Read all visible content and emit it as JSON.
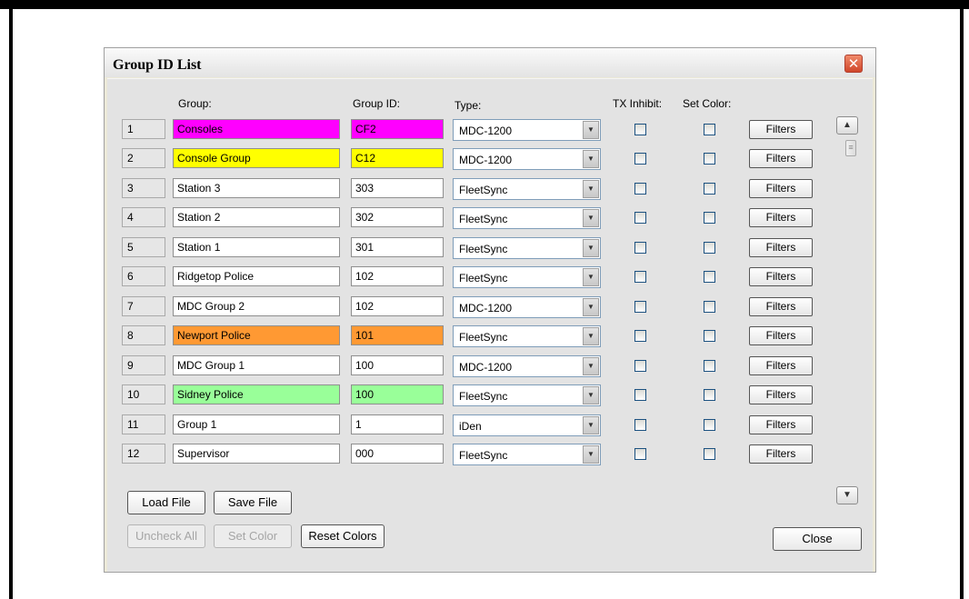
{
  "dialog": {
    "title": "Group ID List",
    "close_glyph": "✕"
  },
  "headers": {
    "group": "Group:",
    "group_id": "Group ID:",
    "type": "Type:",
    "tx_inhibit": "TX Inhibit:",
    "set_color": "Set Color:"
  },
  "rows": [
    {
      "num": "1",
      "group": "Consoles",
      "group_id": "CF2",
      "type": "MDC-1200",
      "color": "#ff00ff"
    },
    {
      "num": "2",
      "group": "Console Group",
      "group_id": "C12",
      "type": "MDC-1200",
      "color": "#ffff00"
    },
    {
      "num": "3",
      "group": "Station 3",
      "group_id": "303",
      "type": "FleetSync",
      "color": "#ffffff"
    },
    {
      "num": "4",
      "group": "Station 2",
      "group_id": "302",
      "type": "FleetSync",
      "color": "#ffffff"
    },
    {
      "num": "5",
      "group": "Station 1",
      "group_id": "301",
      "type": "FleetSync",
      "color": "#ffffff"
    },
    {
      "num": "6",
      "group": "Ridgetop Police",
      "group_id": "102",
      "type": "FleetSync",
      "color": "#ffffff"
    },
    {
      "num": "7",
      "group": "MDC Group 2",
      "group_id": "102",
      "type": "MDC-1200",
      "color": "#ffffff"
    },
    {
      "num": "8",
      "group": "Newport Police",
      "group_id": "101",
      "type": "FleetSync",
      "color": "#ff9933"
    },
    {
      "num": "9",
      "group": "MDC Group 1",
      "group_id": "100",
      "type": "MDC-1200",
      "color": "#ffffff"
    },
    {
      "num": "10",
      "group": "Sidney Police",
      "group_id": "100",
      "type": "FleetSync",
      "color": "#99ff99"
    },
    {
      "num": "11",
      "group": "Group 1",
      "group_id": "1",
      "type": "iDen",
      "color": "#ffffff"
    },
    {
      "num": "12",
      "group": "Supervisor",
      "group_id": "000",
      "type": "FleetSync",
      "color": "#ffffff"
    }
  ],
  "filters_label": "Filters",
  "combo_arrow": "▼",
  "scroll": {
    "up": "▲",
    "down": "▼",
    "thumb": "≡"
  },
  "buttons": {
    "load_file": "Load File",
    "save_file": "Save File",
    "uncheck_all": "Uncheck All",
    "set_color": "Set Color",
    "reset_colors": "Reset Colors",
    "close": "Close"
  }
}
